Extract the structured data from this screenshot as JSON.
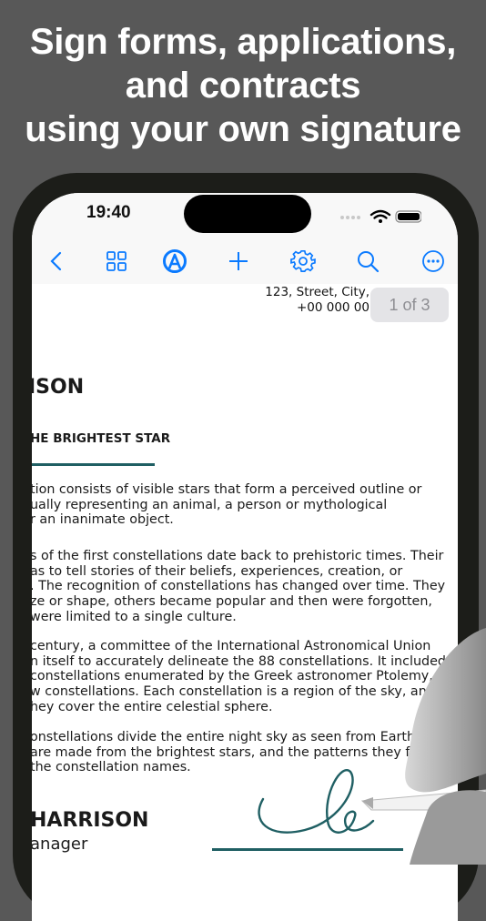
{
  "headline": [
    "Sign forms, applications,",
    "and contracts",
    "using your own signature"
  ],
  "status": {
    "time": "19:40"
  },
  "toolbar": {
    "icons": [
      "chevron-left-icon",
      "grid-icon",
      "markup-pen-icon",
      "plus-icon",
      "gear-icon",
      "search-icon",
      "more-icon"
    ]
  },
  "colors": {
    "accent": "#0a7aff",
    "teal": "#1f5f63",
    "background": "#585858"
  },
  "document": {
    "address": [
      "123, Street, City,",
      "+00 000 00"
    ],
    "page_indicator": "1 of 3",
    "name_heading": "ISON",
    "subheading": "HE BRIGHTEST STAR",
    "paragraphs": [
      [
        "tion consists of visible stars that form a perceived outline or",
        "ually representing an animal, a person or mythological",
        "r an inanimate object."
      ],
      [
        "s of the first constellations date back to prehistoric times. Their",
        "as to tell stories of their beliefs, experiences, creation, or",
        ". The recognition of constellations has changed over time. They",
        "ze or shape, others became popular and then were forgotten,",
        "were limited to a single culture."
      ],
      [
        " century, a committee of the International Astronomical Union",
        "n itself to accurately delineate the 88 constellations. It included",
        "constellations enumerated by the Greek astronomer Ptolemy,",
        "w constellations. Each constellation is a region of the sky, and",
        "hey cover the entire celestial sphere."
      ],
      [
        "onstellations divide the entire night sky as seen from Earth.",
        "are made from the brightest stars, and the patterns they form",
        " the constellation names."
      ]
    ],
    "signer_name": "HARRISON",
    "signer_title": "anager"
  }
}
